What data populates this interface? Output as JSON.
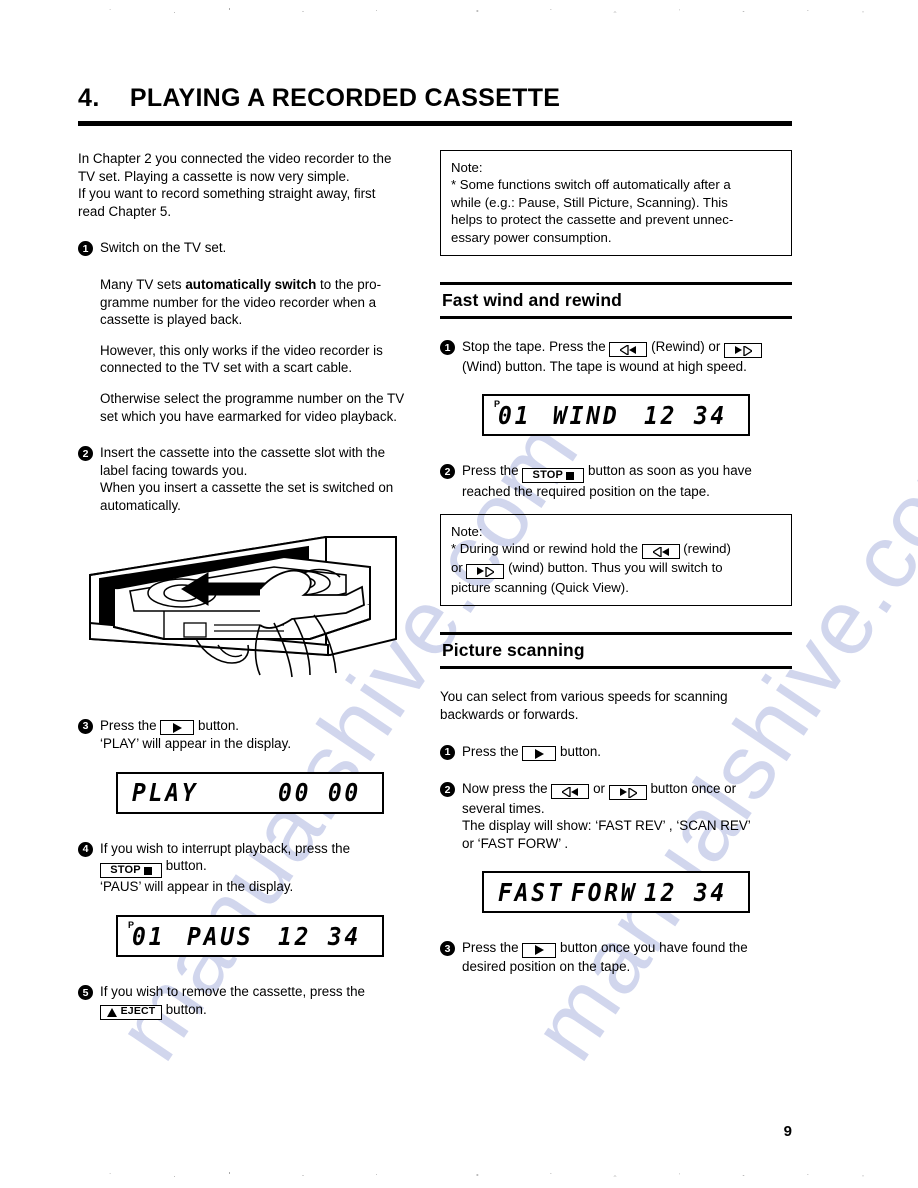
{
  "document": {
    "chapter_number": "4.",
    "chapter_title": "PLAYING A RECORDED CASSETTE",
    "page_number": "9",
    "watermark": "manualshive.com"
  },
  "left_column": {
    "intro": [
      "In Chapter 2 you connected the video recorder to the",
      "TV set. Playing a cassette is now very simple.",
      "If you want to record something straight away, first",
      "read Chapter 5."
    ],
    "step1": {
      "number": "1",
      "text": "Switch on the TV set.",
      "para1_a": "Many TV sets ",
      "para1_bold": "automatically switch",
      "para1_b": " to the pro-gramme number for the video recorder when a cassette is played back.",
      "para2": "However, this only works if the video recorder is connected to the TV set with a scart cable.",
      "para3": "Otherwise select the programme number on the TV set which you have earmarked for video playback."
    },
    "step2": {
      "number": "2",
      "line1": "Insert the cassette into the cassette slot with the",
      "line2": "label facing towards you.",
      "line3": "When you insert a cassette the set is switched on",
      "line4": "automatically."
    },
    "illustration_name": "cassette-insertion-illustration",
    "step3": {
      "number": "3",
      "before": "Press the",
      "button": "play-button",
      "after": "button.",
      "line2": "‘PLAY’ will appear in the display."
    },
    "display_play": {
      "programme_indicator": "",
      "programme": "",
      "mode": "PLAY",
      "counter": "00 00"
    },
    "step4": {
      "number": "4",
      "line1": "If you wish to interrupt playback, press the",
      "button_label": "STOP",
      "after": "button.",
      "line2": "‘PAUS’ will appear in the display."
    },
    "display_paus": {
      "programme_indicator": "P",
      "programme": "01",
      "mode": "PAUS",
      "counter": "12 34"
    },
    "step5": {
      "number": "5",
      "line1": "If you wish to remove the cassette, press the",
      "button_label": "EJECT",
      "after": "button."
    }
  },
  "right_column": {
    "note1": {
      "heading": "Note:",
      "lines": [
        "* Some functions switch off automatically after a",
        "while (e.g.: Pause, Still Picture, Scanning). This",
        "helps to protect the cassette and prevent unnec-",
        "essary power consumption."
      ]
    },
    "section_fast_wind": {
      "title": "Fast wind and rewind",
      "step1": {
        "number": "1",
        "t1": "Stop the tape. Press the",
        "t2": "(Rewind) or",
        "t3": "",
        "line2": "(Wind) button. The tape is wound at high speed."
      },
      "display_wind": {
        "programme_indicator": "P",
        "programme": "01",
        "mode": "WIND",
        "counter": "12 34"
      },
      "step2": {
        "number": "2",
        "t1": "Press the",
        "button_label": "STOP",
        "t2": "button as soon as you have",
        "line2": "reached the required position on the tape."
      },
      "note2": {
        "heading": "Note:",
        "l1a": "* During wind or rewind hold the",
        "l1b": "(rewind)",
        "l2a": "or",
        "l2b": "(wind) button. Thus you will switch to",
        "l3": "picture scanning (Quick View)."
      }
    },
    "section_picture_scanning": {
      "title": "Picture scanning",
      "intro1": "You can select from various speeds for scanning",
      "intro2": "backwards or forwards.",
      "step1": {
        "number": "1",
        "before": "Press the",
        "after": "button."
      },
      "step2": {
        "number": "2",
        "t1": "Now press the",
        "t2": "or",
        "t3": "button once or",
        "line2": "several times.",
        "line3": "The display will show: ‘FAST REV’ , ‘SCAN REV’",
        "line4": "or ‘FAST FORW’ ."
      },
      "display_fast_forw": {
        "mode_left": "FAST",
        "mode_right": "FORW",
        "counter": "12 34"
      },
      "step3": {
        "number": "3",
        "before": "Press the",
        "after": "button once you have found the",
        "line2": "desired position on the tape."
      }
    }
  }
}
